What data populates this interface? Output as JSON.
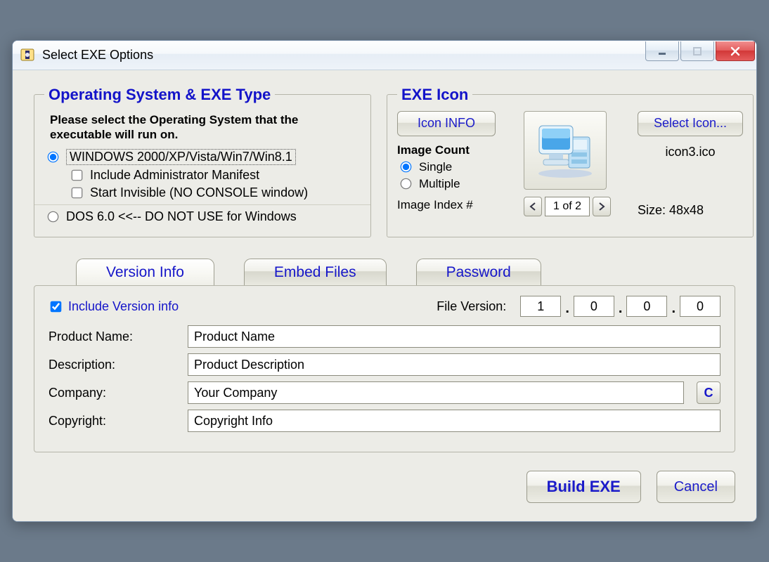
{
  "window": {
    "title": "Select EXE Options"
  },
  "os_group": {
    "legend": "Operating System & EXE Type",
    "hint": "Please select the Operating System that the executable will run on.",
    "opt_windows": "WINDOWS   2000/XP/Vista/Win7/Win8.1",
    "opt_admin_manifest": "Include Administrator Manifest",
    "opt_start_invisible": "Start Invisible   (NO CONSOLE window)",
    "opt_dos": "DOS 6.0 <<-- DO NOT USE for Windows"
  },
  "icon_group": {
    "legend": "EXE Icon",
    "btn_icon_info": "Icon INFO",
    "image_count_label": "Image Count",
    "opt_single": "Single",
    "opt_multiple": "Multiple",
    "image_index_label": "Image Index #",
    "btn_select_icon": "Select Icon...",
    "icon_filename": "icon3.ico",
    "spin_value": "1 of 2",
    "size_label": "Size: 48x48"
  },
  "tabs": {
    "version_info": "Version Info",
    "embed_files": "Embed Files",
    "password": "Password"
  },
  "version_panel": {
    "include_version": "Include Version info",
    "file_version_label": "File Version:",
    "fv": [
      "1",
      "0",
      "0",
      "0"
    ],
    "product_name_label": "Product Name:",
    "product_name_value": "Product Name",
    "description_label": "Description:",
    "description_value": "Product Description",
    "company_label": "Company:",
    "company_value": "Your Company",
    "copyright_label": "Copyright:",
    "copyright_value": "Copyright Info",
    "c_button": "C"
  },
  "footer": {
    "build": "Build EXE",
    "cancel": "Cancel"
  }
}
